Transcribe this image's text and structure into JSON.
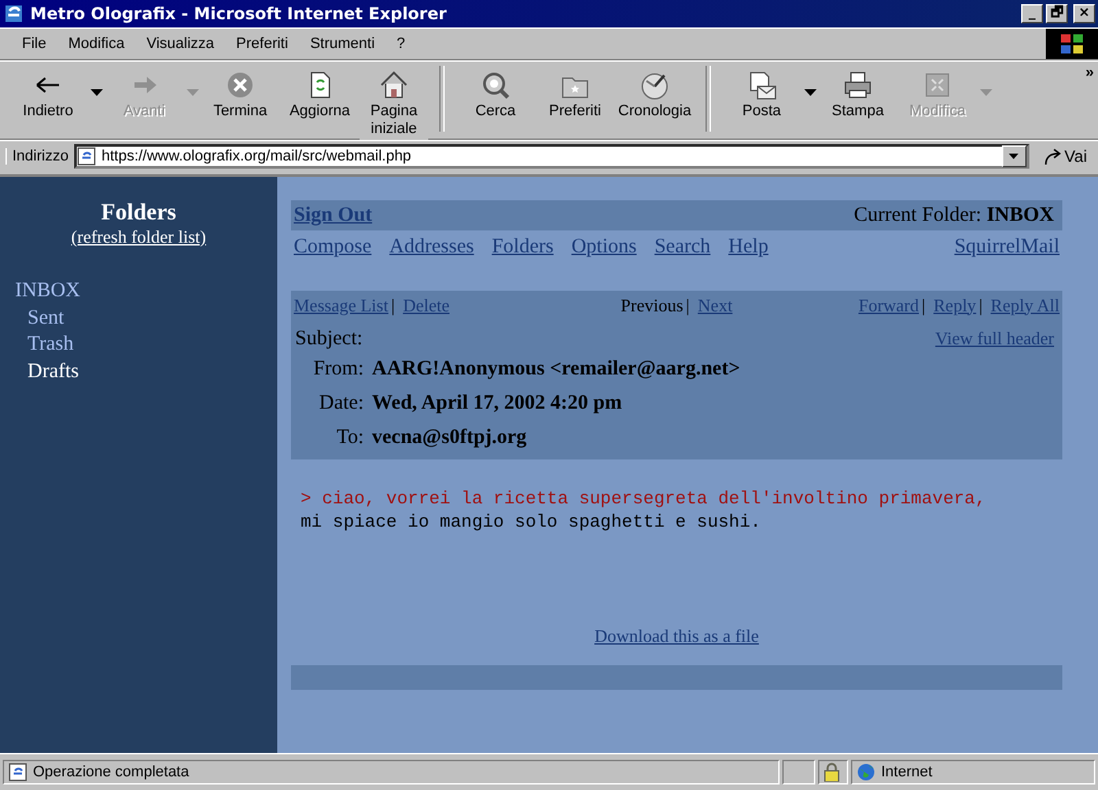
{
  "window": {
    "title": "Metro Olografix - Microsoft Internet Explorer",
    "controls": [
      "_",
      "🗗",
      "×"
    ]
  },
  "menu": [
    "File",
    "Modifica",
    "Visualizza",
    "Preferiti",
    "Strumenti",
    "?"
  ],
  "toolbar": [
    [
      {
        "label": "Indietro",
        "disabled": false,
        "dropdown": true
      },
      {
        "label": "Avanti",
        "disabled": true,
        "dropdown": true
      },
      {
        "label": "Termina",
        "disabled": false,
        "dropdown": false
      },
      {
        "label": "Aggiorna",
        "disabled": false,
        "dropdown": false
      },
      {
        "label": "Pagina iniziale",
        "disabled": false,
        "dropdown": false
      }
    ],
    [
      {
        "label": "Cerca",
        "disabled": false,
        "dropdown": false
      },
      {
        "label": "Preferiti",
        "disabled": false,
        "dropdown": false
      },
      {
        "label": "Cronologia",
        "disabled": false,
        "dropdown": false
      }
    ],
    [
      {
        "label": "Posta",
        "disabled": false,
        "dropdown": true
      },
      {
        "label": "Stampa",
        "disabled": false,
        "dropdown": false
      },
      {
        "label": "Modifica",
        "disabled": true,
        "dropdown": true
      }
    ]
  ],
  "toolbar_more": "»",
  "address": {
    "label": "Indirizzo",
    "value": "https://www.olografix.org/mail/src/webmail.php",
    "go": "Vai"
  },
  "sidebar": {
    "title": "Folders",
    "refresh": "(refresh folder list)",
    "items": [
      {
        "label": "INBOX",
        "color": "#a8bff0",
        "children": [
          {
            "label": "Sent",
            "color": "#a8bff0"
          },
          {
            "label": "Trash",
            "color": "#a8bff0"
          },
          {
            "label": "Drafts",
            "color": "#ffffff"
          }
        ]
      }
    ]
  },
  "top_bar": {
    "sign_out": "Sign Out",
    "current_folder_label": "Current Folder:",
    "current_folder": "INBOX"
  },
  "nav": {
    "links": [
      "Compose",
      "Addresses",
      "Folders",
      "Options",
      "Search",
      "Help"
    ],
    "brand": "SquirrelMail"
  },
  "message_bar": {
    "left": [
      {
        "label": "Message List",
        "separator": "|"
      },
      {
        "label": "Delete"
      }
    ],
    "previous": "Previous",
    "previous_separator": "|",
    "next": "Next",
    "right": [
      {
        "label": "Forward",
        "separator": "|"
      },
      {
        "label": "Reply",
        "separator": "|"
      },
      {
        "label": "Reply All"
      }
    ]
  },
  "headers": {
    "subject_label": "Subject:",
    "view_full": "View full header",
    "fields": [
      {
        "label": "From:",
        "value": "AARG!Anonymous <remailer@aarg.net>"
      },
      {
        "label": "Date:",
        "value": "Wed, April 17, 2002 4:20 pm"
      },
      {
        "label": "To:",
        "value": "vecna@s0ftpj.org"
      }
    ]
  },
  "body": [
    {
      "text": "> ciao, vorrei la ricetta supersegreta dell'involtino primavera,",
      "kind": "quote"
    },
    {
      "text": "mi spiace io mangio solo spaghetti e sushi.",
      "kind": "plain"
    }
  ],
  "download": "Download this as a file",
  "status_bar": {
    "text": "Operazione completata",
    "zone": "Internet"
  }
}
